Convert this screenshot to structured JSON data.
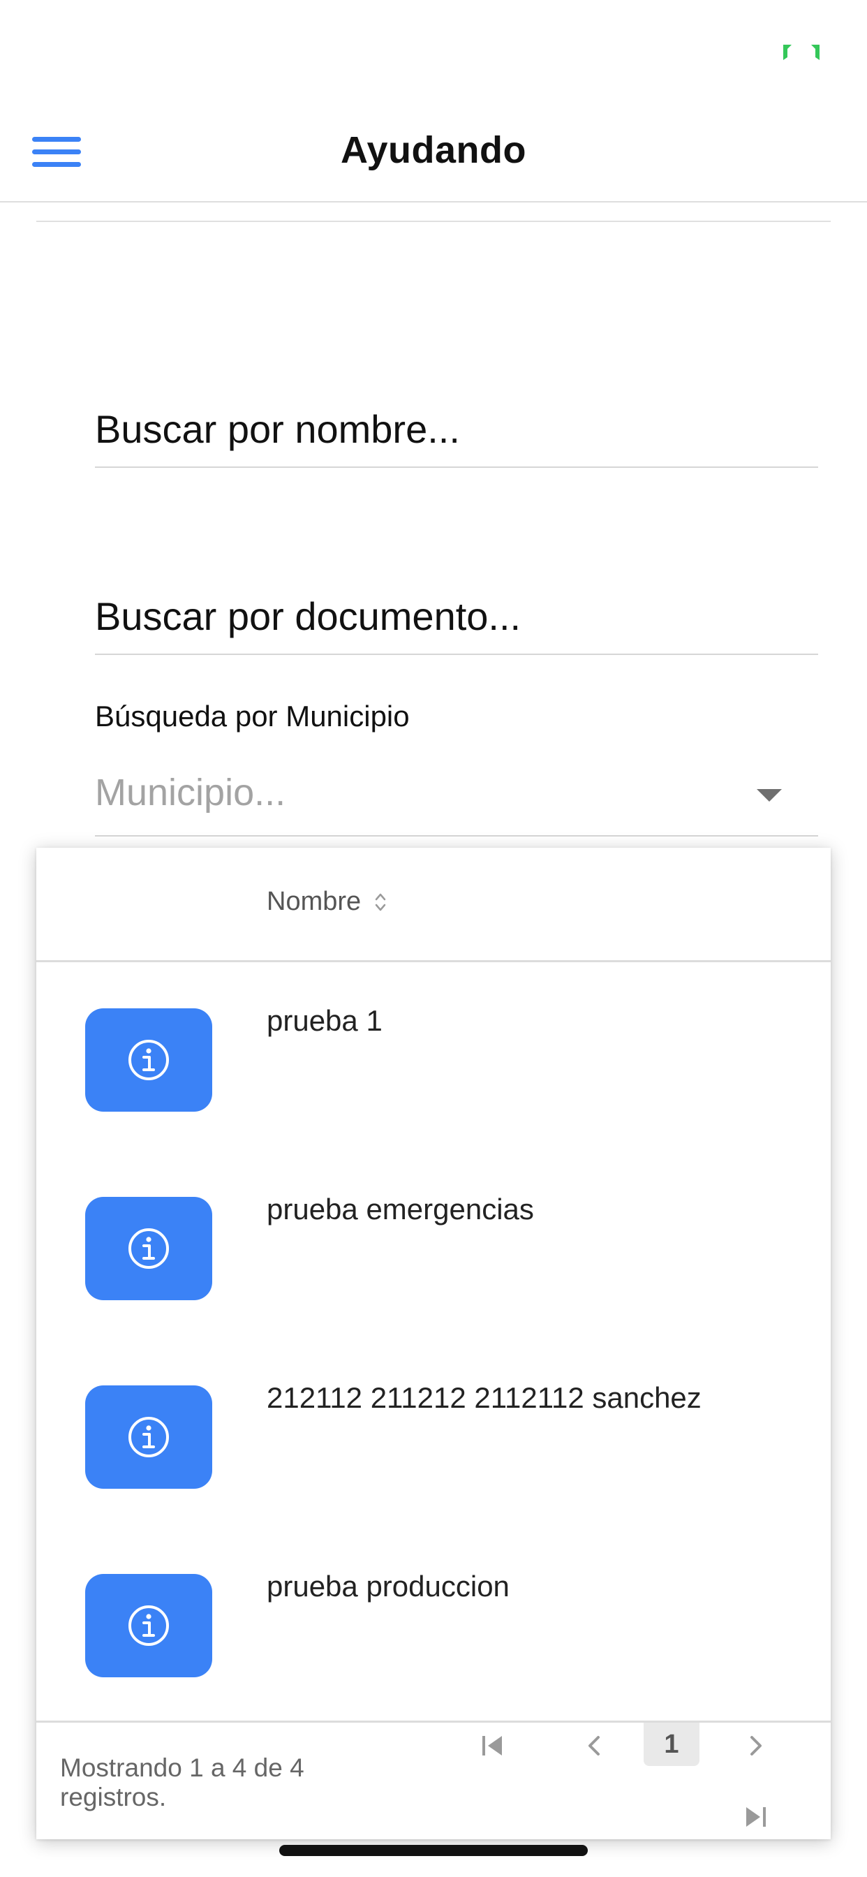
{
  "status_bar": {
    "indicator_icon": "fullscreen-corners-icon",
    "indicator_color": "#34c759"
  },
  "header": {
    "title": "Ayudando",
    "menu_icon": "hamburger-menu-icon",
    "accent_color": "#3b82f6"
  },
  "search": {
    "name_placeholder": "Buscar por nombre...",
    "name_value": "",
    "document_placeholder": "Buscar por documento...",
    "document_value": ""
  },
  "municipio": {
    "label": "Búsqueda por Municipio",
    "placeholder": "Municipio...",
    "caret_icon": "caret-down-icon"
  },
  "table": {
    "column_header": "Nombre",
    "sort_icon": "sort-updown-icon",
    "action_icon": "info-circle-icon",
    "button_color": "#3b82f6",
    "rows": [
      {
        "name": "prueba 1"
      },
      {
        "name": "prueba emergencias"
      },
      {
        "name": "212112 211212 2112112 sanchez"
      },
      {
        "name": "prueba produccion"
      }
    ]
  },
  "pagination": {
    "info": "Mostrando 1 a 4 de 4 registros.",
    "current_page": "1",
    "first_icon": "first-page-icon",
    "prev_icon": "chevron-left-icon",
    "next_icon": "chevron-right-icon",
    "last_icon": "last-page-icon"
  }
}
